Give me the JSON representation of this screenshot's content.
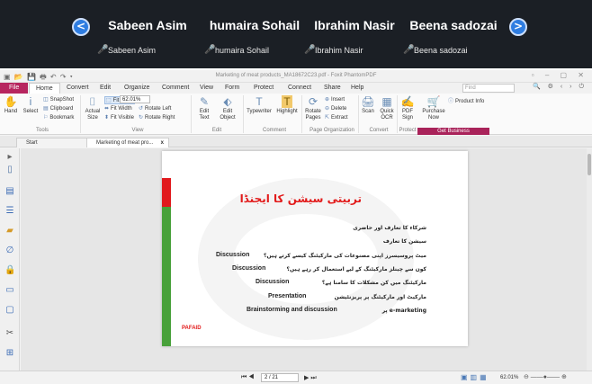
{
  "meeting": {
    "participants": [
      {
        "name": "Sabeen Asim",
        "label": "Sabeen Asim"
      },
      {
        "name": "humaira Sohail",
        "label": "humaira Sohail"
      },
      {
        "name": "Ibrahim Nasir",
        "label": "Ibrahim Nasir"
      },
      {
        "name": "Beena sadozai",
        "label": "Beena sadozai"
      }
    ],
    "prev_icon": "<",
    "next_icon": ">",
    "mic_icon": "🎤"
  },
  "window": {
    "title": "Marketing of meat products_MA18672C23.pdf - Foxit PhantomPDF"
  },
  "menu": {
    "file": "File",
    "home": "Home",
    "convert": "Convert",
    "edit": "Edit",
    "organize": "Organize",
    "comment": "Comment",
    "view": "View",
    "form": "Form",
    "protect": "Protect",
    "connect": "Connect",
    "share": "Share",
    "help": "Help",
    "find_placeholder": "Find"
  },
  "ribbon": {
    "hand": "Hand",
    "select": "Select",
    "snapshot": "SnapShot",
    "clipboard": "Clipboard",
    "bookmark": "Bookmark",
    "actual_size": "Actual Size",
    "fit_page": "Fit Page",
    "fit_width": "Fit Width",
    "fit_visible": "Fit Visible",
    "zoom": "62.01%",
    "rotate_left": "Rotate Left",
    "rotate_right": "Rotate Right",
    "edit_text": "Edit Text",
    "edit_object": "Edit Object",
    "typewriter": "Typewriter",
    "highlight": "Highlight",
    "rotate_pages": "Rotate Pages",
    "insert": "Insert",
    "delete": "Delete",
    "extract": "Extract",
    "scan": "Scan",
    "quick_ocr": "Quick OCR",
    "pdf_sign": "PDF Sign",
    "purchase_now": "Purchase Now",
    "product_info": "Product Info",
    "groups": {
      "tools": "Tools",
      "view": "View",
      "edit": "Edit",
      "comment": "Comment",
      "page_org": "Page Organization",
      "convert": "Convert",
      "protect": "Protect",
      "get_business": "Get Business"
    },
    "accent": "#a9235a"
  },
  "tabs": {
    "start": "Start",
    "doc": "Marketing of meat pro...",
    "close": "x"
  },
  "slide": {
    "title": "تربیتی سیشن کا ایجنڈا",
    "lines": [
      "شرکاء کا تعارف اور حاضری",
      "سیشن کا تعارف",
      "میٹ پروسیسرز اپنی مصنوعات کی مارکیٹنگ کیسے کرتے ہیں؟",
      "کون سے چینلز مارکیٹنگ کے لیے استعمال کر رہے ہیں؟",
      "مارکیٹنگ میں کن مشکلات کا سامنا ہے؟",
      "مارکیٹ اور مارکیٹنگ پر پریزنٹیشن",
      "e-marketing پر"
    ],
    "tags": [
      "Discussion",
      "Discussion",
      "Discussion",
      "Presentation",
      "Brainstorming and discussion"
    ],
    "logo": "PAFAID"
  },
  "status": {
    "page": "2 / 21",
    "zoom": "62.01%"
  }
}
